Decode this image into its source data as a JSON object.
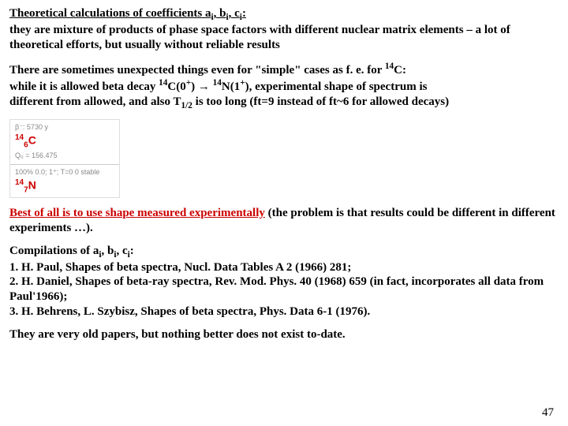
{
  "heading": {
    "title_part1": "Theoretical calculations of coefficients a",
    "title_part2": ", b",
    "title_part3": ", c",
    "title_part4": ":",
    "body": "they are mixture of products of phase space factors with different nuclear matrix elements – a lot of theoretical efforts, but usually without reliable results"
  },
  "para2": {
    "l1a": "There are sometimes unexpected things even for \"simple\" cases as f. e. for ",
    "l1b": "C:",
    "l2a": "while it is allowed beta decay ",
    "l2b": "C(0",
    "l2c": ") ",
    "arrow": "→",
    "l2d": " ",
    "l2e": "N(1",
    "l2f": "), experimental shape of spectrum is",
    "l3a": "different from allowed, and also T",
    "l3b": " is too long (ft=9 instead of ft~6 for allowed decays)"
  },
  "figure": {
    "top_text": "β⁻: 5730 y",
    "nuclide_top": "C",
    "nuclide_top_A": "14",
    "nuclide_top_Z": "6",
    "q_text": "Q₀ = 156.475",
    "bot_text": "100%   0.0; 1⁺; T=0   0   stable",
    "nuclide_bot": "N",
    "nuclide_bot_A": "14",
    "nuclide_bot_Z": "7"
  },
  "para3": {
    "red_underline": "Best of all is to use shape measured experimentally",
    "rest": " (the problem is that results could be different in different experiments …)."
  },
  "para4": {
    "l1a": "Compilations of a",
    "l1b": ", b",
    "l1c": ", c",
    "l1d": ":",
    "l2": "1. H. Paul, Shapes of beta spectra, Nucl. Data Tables A 2 (1966) 281;",
    "l3": "2. H. Daniel, Shapes of beta-ray spectra, Rev. Mod. Phys. 40 (1968) 659 (in fact, incorporates all data from Paul'1966);",
    "l4": "3. H. Behrens, L. Szybisz, Shapes of beta spectra, Phys. Data 6-1 (1976)."
  },
  "para5": "They are very old papers, but nothing better does not exist to-date.",
  "page_number": "47",
  "sub_i": "i",
  "sup_14": "14",
  "sup_plus": "+",
  "sub_half": "1/2"
}
